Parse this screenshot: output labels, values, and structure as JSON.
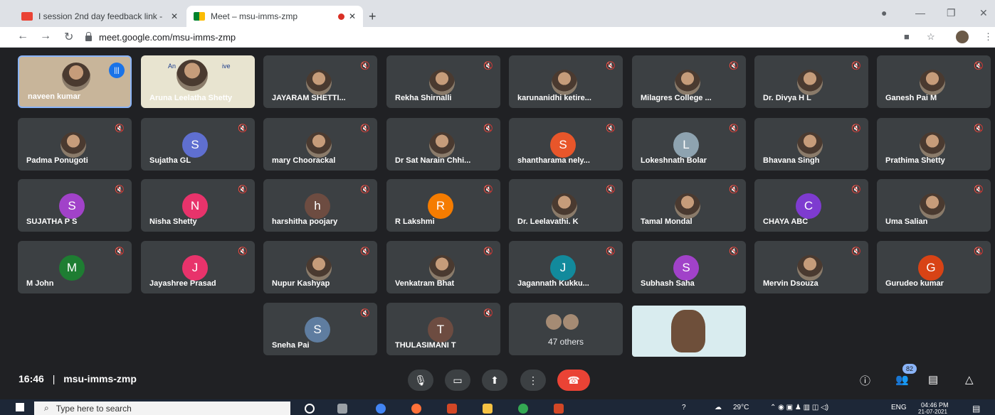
{
  "browser": {
    "tabs": [
      {
        "title": "I session 2nd day feedback link -",
        "active": false
      },
      {
        "title": "Meet – msu-imms-zmp",
        "active": true
      }
    ],
    "url": "meet.google.com/msu-imms-zmp"
  },
  "self_tile": {
    "name": "naveen kumar"
  },
  "screen_tile": {
    "name": "Aruna Leelatha Shetty",
    "text1": "An",
    "text2": "ive"
  },
  "participants": [
    {
      "name": "JAYARAM SHETTI...",
      "initial": "",
      "color": ""
    },
    {
      "name": "Rekha Shirnalli",
      "initial": "",
      "color": ""
    },
    {
      "name": "karunanidhi ketire...",
      "initial": "",
      "color": ""
    },
    {
      "name": "Milagres College ...",
      "initial": "",
      "color": ""
    },
    {
      "name": "Dr. Divya H L",
      "initial": "",
      "color": ""
    },
    {
      "name": "Ganesh Pai M",
      "initial": "",
      "color": ""
    },
    {
      "name": "Padma Ponugoti",
      "initial": "",
      "color": ""
    },
    {
      "name": "Sujatha GL",
      "initial": "S",
      "color": "#5f6fd0"
    },
    {
      "name": "mary Choorackal",
      "initial": "",
      "color": ""
    },
    {
      "name": "Dr Sat Narain Chhi...",
      "initial": "",
      "color": ""
    },
    {
      "name": "shantharama nely...",
      "initial": "S",
      "color": "#e8562a"
    },
    {
      "name": "Lokeshnath Bolar",
      "initial": "L",
      "color": "#8ea3b0"
    },
    {
      "name": "Bhavana Singh",
      "initial": "",
      "color": ""
    },
    {
      "name": "Prathima Shetty",
      "initial": "",
      "color": ""
    },
    {
      "name": "SUJATHA P S",
      "initial": "S",
      "color": "#a142c9"
    },
    {
      "name": "Nisha Shetty",
      "initial": "N",
      "color": "#e8336b"
    },
    {
      "name": "harshitha poojary",
      "initial": "h",
      "color": "#6d4c41"
    },
    {
      "name": "R Lakshmi",
      "initial": "R",
      "color": "#f57c00"
    },
    {
      "name": "Dr. Leelavathi. K",
      "initial": "",
      "color": ""
    },
    {
      "name": "Tamal Mondal",
      "initial": "",
      "color": ""
    },
    {
      "name": "CHAYA ABC",
      "initial": "C",
      "color": "#7e3bd0"
    },
    {
      "name": "Uma Salian",
      "initial": "",
      "color": ""
    },
    {
      "name": "M John",
      "initial": "M",
      "color": "#1e7d32"
    },
    {
      "name": "Jayashree Prasad",
      "initial": "J",
      "color": "#e8336b"
    },
    {
      "name": "Nupur Kashyap",
      "initial": "",
      "color": ""
    },
    {
      "name": "Venkatram Bhat",
      "initial": "",
      "color": ""
    },
    {
      "name": "Jagannath Kukku...",
      "initial": "J",
      "color": "#128a9c"
    },
    {
      "name": "Subhash Saha",
      "initial": "S",
      "color": "#a142c9"
    },
    {
      "name": "Mervin Dsouza",
      "initial": "",
      "color": ""
    },
    {
      "name": "Gurudeo kumar",
      "initial": "G",
      "color": "#d84315"
    },
    {
      "name": "Sneha Pai",
      "initial": "S",
      "color": "#5f7da0"
    },
    {
      "name": "THULASIMANI T",
      "initial": "T",
      "color": "#6d4c41"
    }
  ],
  "others_tile": {
    "label": "47 others"
  },
  "meeting": {
    "time": "16:46",
    "separator": "|",
    "code": "msu-imms-zmp",
    "participant_count": "82"
  },
  "taskbar": {
    "search_placeholder": "Type here to search",
    "weather": "29°C",
    "lang": "ENG",
    "clock": "04:46 PM",
    "date": "21-07-2021"
  }
}
